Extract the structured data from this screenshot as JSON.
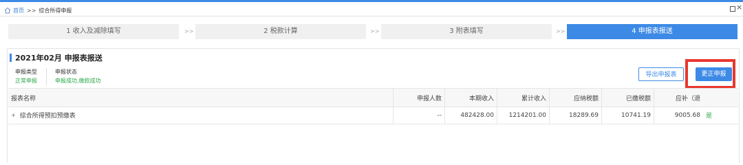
{
  "breadcrumb": {
    "home": "首页",
    "separator": ">>",
    "current": "综合所得申报"
  },
  "window": {
    "restore_icon": "restore-icon",
    "close_icon": "close-icon",
    "close_glyph": "×"
  },
  "steps": [
    {
      "label": "1 收入及减除填写",
      "active": false
    },
    {
      "label": "2 税款计算",
      "active": false
    },
    {
      "label": "3 附表填写",
      "active": false
    },
    {
      "label": "4 申报表报送",
      "active": true
    }
  ],
  "step_separator": ">>",
  "section": {
    "title": "2021年02月  申报表报送"
  },
  "info": {
    "type_label": "申报类型",
    "type_value": "正常申报",
    "status_label": "申报状态",
    "status_value": "申报成功,缴款成功"
  },
  "buttons": {
    "export": "导出申报表",
    "correct": "更正申报"
  },
  "table": {
    "headers": [
      "报表名称",
      "申报人数",
      "本期收入",
      "累计收入",
      "应纳税额",
      "已缴税额",
      "应补（退"
    ],
    "rows": [
      {
        "expander": "+",
        "name": "综合所得预扣预缴表",
        "count": "--",
        "current_income": "482428.00",
        "cumulative_income": "1214201.00",
        "tax_payable": "18289.69",
        "tax_paid": "10741.19",
        "tax_due": "9005.68",
        "flag": "是"
      }
    ]
  },
  "colors": {
    "accent": "#3d8ae6",
    "success": "#2aa84a",
    "highlight": "#e8372e"
  }
}
